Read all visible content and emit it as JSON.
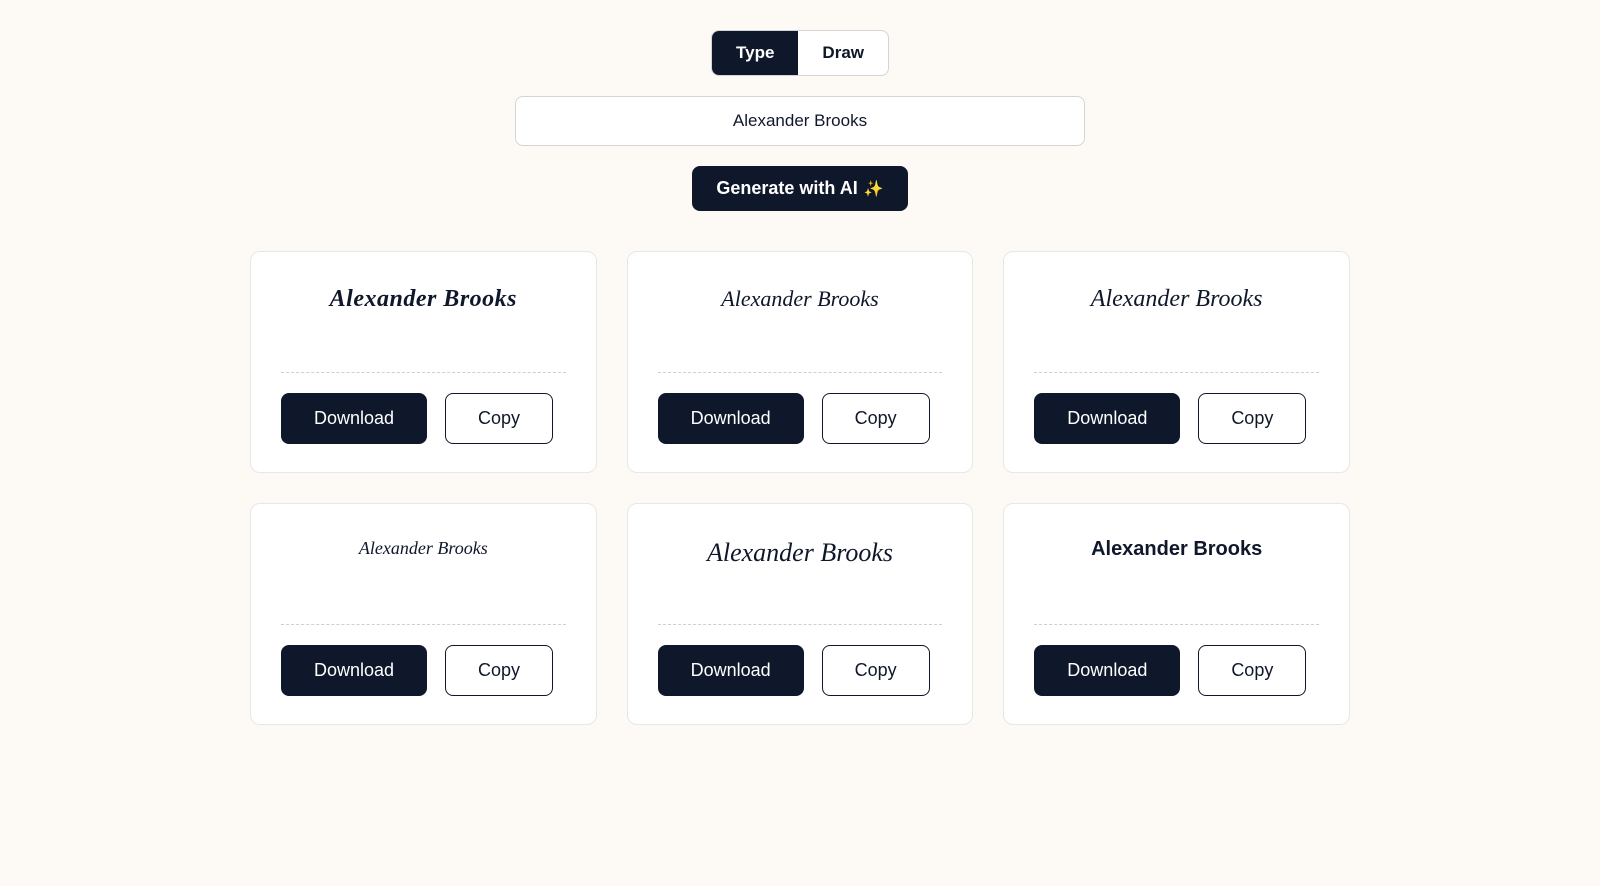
{
  "tabs": {
    "type_label": "Type",
    "draw_label": "Draw",
    "active": "type"
  },
  "input": {
    "value": "Alexander Brooks"
  },
  "generate": {
    "label": "Generate with AI",
    "sparkle": "✨"
  },
  "signatures": [
    {
      "text": "Alexander Brooks"
    },
    {
      "text": "Alexander Brooks"
    },
    {
      "text": "Alexander Brooks"
    },
    {
      "text": "Alexander Brooks"
    },
    {
      "text": "Alexander Brooks"
    },
    {
      "text": "Alexander Brooks"
    }
  ],
  "buttons": {
    "download": "Download",
    "copy": "Copy"
  }
}
